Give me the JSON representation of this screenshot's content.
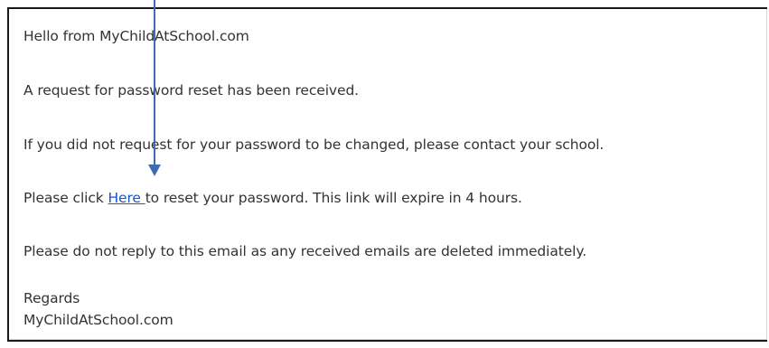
{
  "email": {
    "greeting": "Hello from MyChildAtSchool.com",
    "request_line": "A request for password reset has been received.",
    "contact_line": "If you did not request for your password to be changed, please contact your school.",
    "click_prefix": "Please click ",
    "link_text": "Here ",
    "click_suffix": "to reset your password. This link will expire in 4 hours.",
    "no_reply_line": "Please do not reply to this email as any received emails are deleted immediately.",
    "regards": "Regards",
    "signature": "MyChildAtSchool.com"
  },
  "annotation": {
    "icon": "down-arrow-icon",
    "color": "#3f6bb5"
  },
  "colors": {
    "link": "#1a56c9",
    "text": "#333333",
    "border": "#1a1a1a"
  }
}
